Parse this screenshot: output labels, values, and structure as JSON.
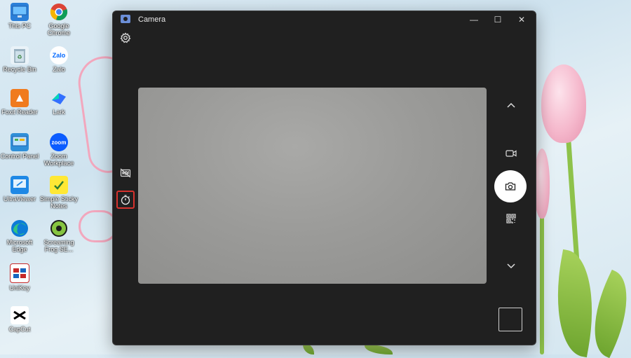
{
  "desktop": {
    "icons": [
      {
        "label": "This PC"
      },
      {
        "label": "Google Chrome"
      },
      {
        "label": "Recycle Bin"
      },
      {
        "label": "Zalo"
      },
      {
        "label": "Foxit Reader"
      },
      {
        "label": "Lark"
      },
      {
        "label": "Control Panel"
      },
      {
        "label": "Zoom Workplace"
      },
      {
        "label": "UltraViewer"
      },
      {
        "label": "Simple Sticky Notes"
      },
      {
        "label": "Microsoft Edge"
      },
      {
        "label": "Screaming Frog SE..."
      },
      {
        "label": "UniKey"
      },
      {
        "label": "CapCut"
      }
    ],
    "icon_glyph_text": {
      "zalo": "Zalo",
      "zoom": "zoom"
    }
  },
  "camera_window": {
    "title": "Camera",
    "window_buttons": {
      "minimize": "—",
      "maximize": "☐",
      "close": "✕"
    }
  },
  "icons": {
    "settings": "gear-icon",
    "hdr_off": "hdr-off-icon",
    "timer": "timer-icon",
    "chevron_up": "chevron-up-icon",
    "video_mode": "video-camera-icon",
    "photo_shutter": "camera-icon",
    "qr_mode": "qr-code-icon",
    "chevron_down": "chevron-down-icon"
  },
  "colors": {
    "window_bg": "#202020",
    "highlight": "#d7322d",
    "shutter": "#ffffff",
    "accent": "#6c8fd8"
  }
}
